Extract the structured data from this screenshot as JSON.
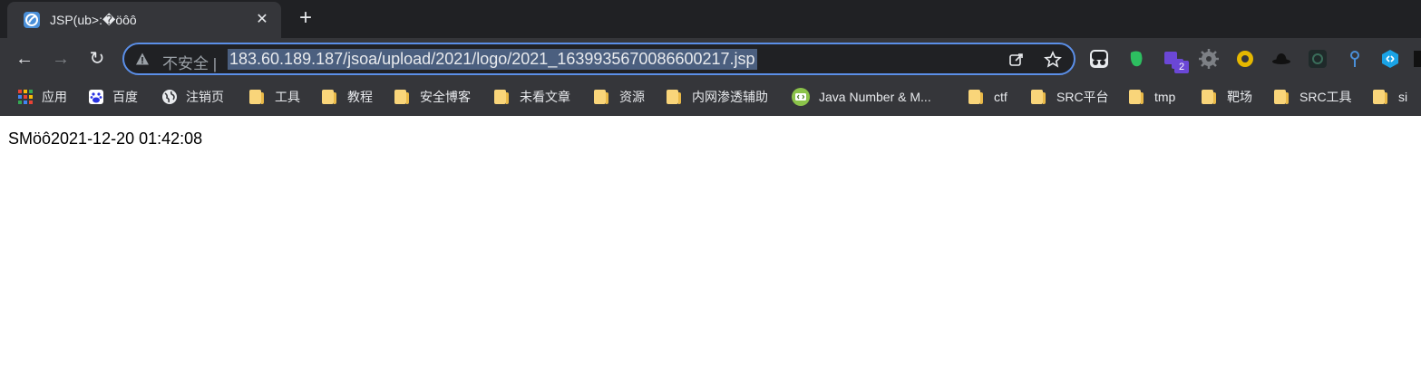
{
  "tab": {
    "title": "JSP(ub>:�öôô",
    "close": "✕"
  },
  "new_tab": "+",
  "nav": {
    "back": "←",
    "forward": "→",
    "reload": "↻"
  },
  "omnibox": {
    "security_label": "不安全",
    "url": "183.60.189.187/jsoa/upload/2021/logo/2021_1639935670086600217.jsp"
  },
  "extensions": {
    "badge_count": "2"
  },
  "bookmarks": [
    {
      "label": "应用",
      "icon": "apps-grid-icon"
    },
    {
      "label": "百度",
      "icon": "baidu-icon"
    },
    {
      "label": "注销页",
      "icon": "globe-icon"
    },
    {
      "label": "工具",
      "icon": "folder-icon"
    },
    {
      "label": "教程",
      "icon": "folder-icon"
    },
    {
      "label": "安全博客",
      "icon": "folder-icon"
    },
    {
      "label": "未看文章",
      "icon": "folder-icon"
    },
    {
      "label": "资源",
      "icon": "folder-icon"
    },
    {
      "label": "内网渗透辅助",
      "icon": "folder-icon"
    },
    {
      "label": "Java Number & M...",
      "icon": "code-badge-icon"
    },
    {
      "label": "ctf",
      "icon": "folder-icon"
    },
    {
      "label": "SRC平台",
      "icon": "folder-icon"
    },
    {
      "label": "tmp",
      "icon": "folder-icon"
    },
    {
      "label": "靶场",
      "icon": "folder-icon"
    },
    {
      "label": "SRC工具",
      "icon": "folder-icon"
    },
    {
      "label": "si",
      "icon": "folder-icon"
    }
  ],
  "page": {
    "text": "SMöô2021-12-20 01:42:08"
  },
  "colors": {
    "accent": "#5b8fe8",
    "toolbar": "#35363a",
    "tabstrip": "#202124"
  }
}
